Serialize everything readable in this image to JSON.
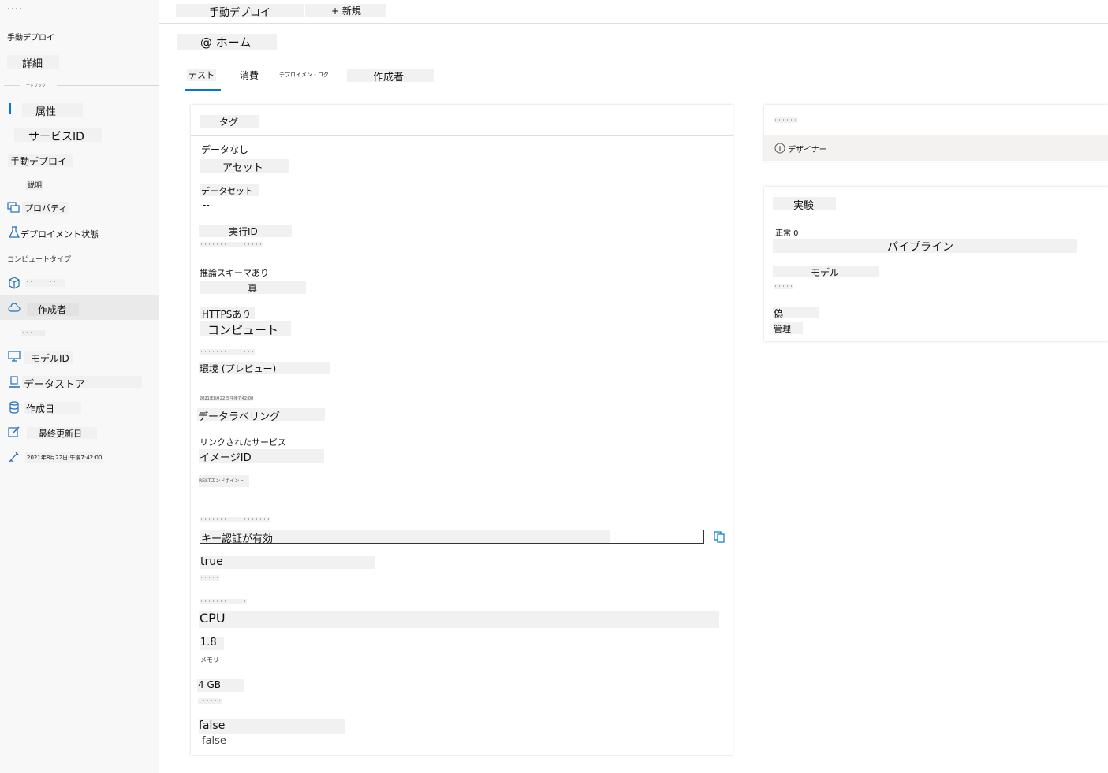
{
  "sidebar": {
    "top_tiny": "・・・・・・",
    "title": "手動デプロイ",
    "details": "詳細",
    "section1": "・ートブック",
    "items1": [
      "属性",
      "サービスID",
      "手動デプロイ"
    ],
    "section2": "説明",
    "items2": [
      "プロパティ",
      "デプロイメント状態",
      "コンピュートタイプ",
      "・・・・・・・・",
      "作成者"
    ],
    "section3": "・・・・・・",
    "items3": [
      "モデルID",
      "データストア",
      "作成日",
      "最終更新日",
      "2021年8月22日 午後7:42:00"
    ]
  },
  "header": {
    "deploy_button": "手動デプロイ",
    "new_button": "+ 新規"
  },
  "home": "@ ホーム",
  "tabs": [
    "テスト",
    "消費",
    "デプロイメン・ログ",
    "作成者"
  ],
  "main_panel": {
    "title": "タグ",
    "fields": {
      "no_data": "データなし",
      "asset": "アセット",
      "dataset_label": "データセット",
      "dataset_value": "--",
      "run_id": "実行ID",
      "run_id_value": "・・・・・・・・・・・・・・・・",
      "schema_label": "推論スキーマあり",
      "schema_value": "真",
      "https_label": "HTTPSあり",
      "compute": "コンピュート",
      "compute_tiny": "・・・・・・・・・・・・・・",
      "environment": "環境 (プレビュー)",
      "date_tiny": "2021年8月22日 午後7:42:00",
      "data_labeling": "データラベリング",
      "linked_service": "リンクされたサービス",
      "image_id": "イメージID",
      "rest_endpoint": "RESTエンドポイント",
      "rest_value": "--",
      "key_tiny": "・・・・・・・・・・・・・・・・・・",
      "key_auth": "キー認証が有効",
      "true_value": "true",
      "tiny2": "・・・・・",
      "tiny3": "・・・・・・・・・・・・",
      "cpu": "CPU",
      "cpu_value": "1.8",
      "memory": "メモリ",
      "memory_value": "4 GB",
      "tiny4": "・・・・・・",
      "false1": "false",
      "false2": "false"
    }
  },
  "side_panel1": {
    "tiny": "・・・・・・",
    "designer": "デザイナー"
  },
  "side_panel2": {
    "title": "実験",
    "status": "正常 0",
    "pipeline": "パイプライン",
    "model": "モデル",
    "tiny": "・・・・・",
    "false_jp": "偽",
    "manage": "管理"
  }
}
